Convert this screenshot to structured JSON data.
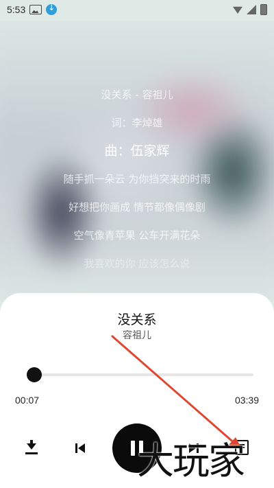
{
  "status_bar": {
    "time": "5:53",
    "icons": [
      "gallery-icon",
      "download-badge-icon",
      "wifi-icon",
      "signal-icon",
      "battery-icon"
    ]
  },
  "lyrics": {
    "lines": [
      "没关系 - 容祖儿",
      "词：李焯雄",
      "曲：伍家辉",
      "随手抓一朵云 为你挡突来的时雨",
      "好想把你画成 情节都像偶像剧",
      "空气像青苹果 公车开满花朵",
      "我喜欢的你 应该怎么说"
    ],
    "active_index": 2
  },
  "player": {
    "title": "没关系",
    "artist": "容祖儿",
    "elapsed": "00:07",
    "total": "03:39",
    "progress_fraction": 0.03,
    "state": "playing"
  },
  "controls": {
    "icons": [
      "download-icon",
      "previous-icon",
      "pause-icon",
      "next-icon",
      "playlist-icon"
    ]
  },
  "colors": {
    "annotation_arrow": "#e0452f",
    "sheet_background": "#ffffff",
    "play_button": "#0b0b0b"
  },
  "watermark": {
    "text": "大玩家"
  }
}
